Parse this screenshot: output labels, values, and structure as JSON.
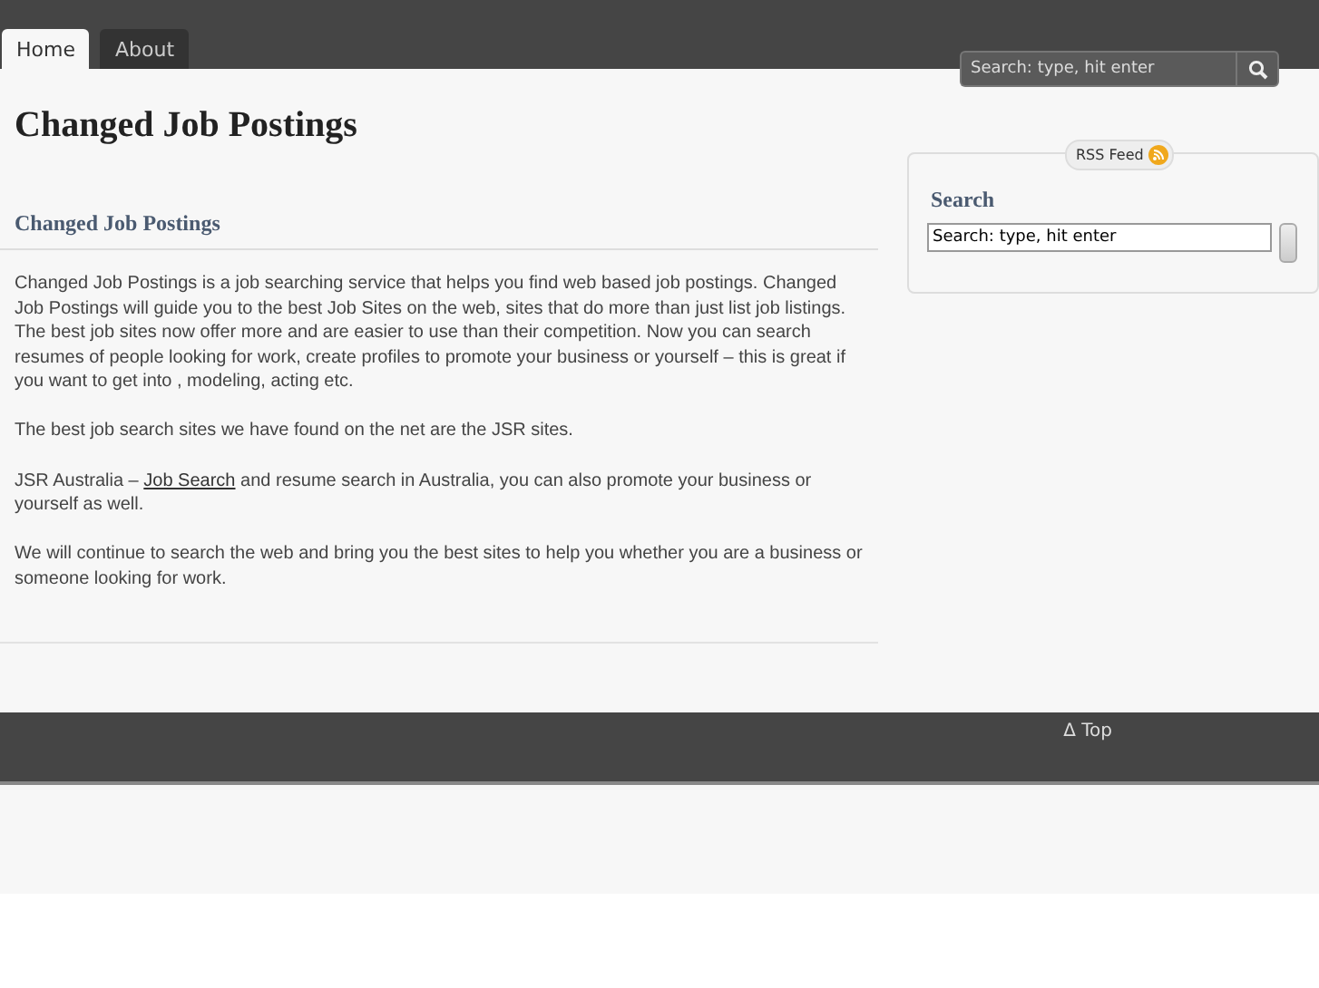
{
  "tabs": [
    {
      "label": "Home",
      "selected": true
    },
    {
      "label": "About",
      "selected": false
    }
  ],
  "header_search": {
    "placeholder": "Search: type, hit enter"
  },
  "site_title": "Changed Job Postings",
  "post": {
    "title": "Changed Job Postings",
    "paragraphs": [
      {
        "text": "Changed Job Postings  is a job searching service that helps you find web based job postings.  Changed Job Postings will guide you to the best  Job Sites on the web, sites that do more than just list job listings. The best job sites now offer more and are easier to use than their competition. Now you can search resumes of people looking for work, create profiles to promote your business or yourself – this is great if you want to get into , modeling, acting etc."
      },
      {
        "text": "The best job search sites we have found on the net are the JSR sites."
      },
      {
        "text": "JSR Australia – ",
        "link": "Job Search",
        "after": " and resume search in Australia, you can also promote your business or yourself as well."
      },
      {
        "text": "We will continue to search the web and bring you the best sites to help you whether you are a business or someone looking for work."
      }
    ]
  },
  "sidebar": {
    "rss_label": "RSS Feed",
    "widget_title": "Search",
    "search_value": "Search: type, hit enter"
  },
  "footer": {
    "top_link": "Δ Top"
  }
}
